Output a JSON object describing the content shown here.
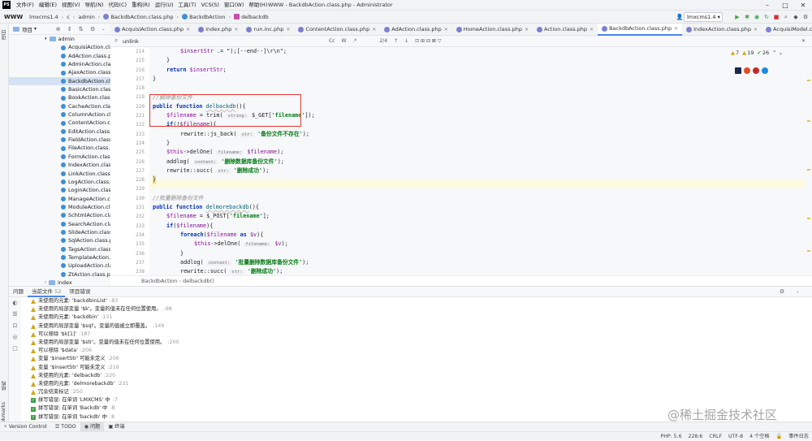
{
  "menu": {
    "items": [
      "文件(F)",
      "编辑(E)",
      "视图(V)",
      "导航(N)",
      "代码(C)",
      "重构(R)",
      "运行(U)",
      "工具(T)",
      "VCS(S)",
      "窗口(W)",
      "帮助(H)"
    ],
    "window_title": "WWW - BackdbAction.class.php - Administrator"
  },
  "nav": {
    "brand": "WWW",
    "crumbs": [
      "lmxcms1.4",
      "c",
      "admin",
      "BackdbAction.class.php",
      "BackdbAction",
      "delbackdb"
    ],
    "run_config": "lmxcms1.4"
  },
  "project": {
    "title": "项目",
    "folder": "admin",
    "files": [
      "AcquisiAction.class.php",
      "AdAction.class.php",
      "AdminAction.class.php",
      "AjaxAction.class.php",
      "BackdbAction.class.php",
      "BasicAction.class.php",
      "BookAction.class.php",
      "CacheAction.class.php",
      "ColumnAction.class.php",
      "ContentAction.class.php",
      "EditAction.class.php",
      "FieldAction.class.php",
      "FileAction.class.php",
      "FormAction.class.php",
      "IndexAction.class.php",
      "LinkAction.class.php",
      "LogAction.class.php",
      "LoginAction.class.php",
      "ManageAction.class.php",
      "ModuleAction.class.php",
      "SchtmlAction.class.php",
      "SearchAction.class.php",
      "SlideAction.class.php",
      "SqlAction.class.php",
      "TagsAction.class.php",
      "TemplateAction.class.php",
      "UploadAction.class.php",
      "ZtAction.class.php"
    ],
    "next_folder": "index"
  },
  "tabs": [
    "AcquisiAction.class.php",
    "index.php",
    "run.inc.php",
    "ContentAction.class.php",
    "AdAction.class.php",
    "HomeAction.class.php",
    "Action.class.php",
    "BackdbAction.class.php",
    "IndexAction.class.php",
    "AcquisiModel.class.php"
  ],
  "search": {
    "query": "unlink",
    "count": "2/4",
    "opts": [
      "Cc",
      "W",
      ".*"
    ]
  },
  "inspections": {
    "warnings": "7",
    "weak": "19",
    "typos": "26"
  },
  "line_numbers": [
    "214",
    "215",
    "216",
    "217",
    "218",
    "219",
    "220",
    "221",
    "222",
    "223",
    "224",
    "225",
    "226",
    "227",
    "228",
    "229",
    "230",
    "231",
    "232",
    "233",
    "234",
    "235",
    "236",
    "237",
    "238"
  ],
  "code": {
    "l214_var": "$insertStr",
    "l214_rest": " .= \");[--end--]\\r\\n\";",
    "l215": "}",
    "l216_kw": "return",
    "l216_var": "$insertStr",
    "l216_end": ";",
    "l217": "}",
    "l219_cmt": "//删除备份文件",
    "l220_kw": "public function",
    "l220_fn": "delbackdb",
    "l220_end": "(){",
    "l221_var": "$filename",
    "l221_a": " = trim(",
    "l221_hint": "string:",
    "l221_b": " $_GET[",
    "l221_str": "'filename'",
    "l221_c": "]);",
    "l222_kw": "if",
    "l222_a": "(!",
    "l222_var": "$filename",
    "l222_b": "){",
    "l223_a": "rewrite::js_back(",
    "l223_hint": "str:",
    "l223_str": "'备份文件不存在'",
    "l223_b": ");",
    "l224": "}",
    "l225_a": "$this",
    "l225_b": "->delOne(",
    "l225_hint": "filename:",
    "l225_var": "$filename",
    "l225_c": ");",
    "l226_a": "addlog(",
    "l226_hint": "content:",
    "l226_str": "'删除数据库备份文件'",
    "l226_b": ");",
    "l227_a": "rewrite::succ(",
    "l227_hint": "str:",
    "l227_str": "'删除成功'",
    "l227_b": ");",
    "l228": "}",
    "l230_cmt": "//批量删除备份文件",
    "l231_kw": "public function",
    "l231_fn": "delmorebackdb",
    "l231_end": "(){",
    "l232_var": "$filename",
    "l232_a": " = $_POST[",
    "l232_str": "'filename'",
    "l232_b": "];",
    "l233_kw": "if",
    "l233_a": "(",
    "l233_var": "$filename",
    "l233_b": "){",
    "l234_kw": "foreach",
    "l234_a": "(",
    "l234_var": "$filename",
    "l234_kw2": " as ",
    "l234_var2": "$v",
    "l234_b": "){",
    "l235_a": "$this",
    "l235_b": "->delOne(",
    "l235_hint": "filename:",
    "l235_var": "$v",
    "l235_c": ");",
    "l236": "}",
    "l237_a": "addlog(",
    "l237_hint": "content:",
    "l237_str": "'批量删除数据库备份文件'",
    "l237_b": ");",
    "l238_a": "rewrite::succ(",
    "l238_hint": "str:",
    "l238_str": "'删除成功'",
    "l238_b": ");"
  },
  "editor_breadcrumb": [
    "BackdbAction",
    "delbackdb()"
  ],
  "problems": {
    "tabs": [
      "问题",
      "当前文件",
      "项目错误"
    ],
    "current_count": "52",
    "items": [
      {
        "type": "warn",
        "text": "未使用的元素: 'backdbinList'",
        "loc": ":83"
      },
      {
        "type": "warn",
        "text": "未使用的局部变量 '$k'。变量的值未在任何位置使用。",
        "loc": ":98"
      },
      {
        "type": "warn",
        "text": "未使用的元素: 'backdbin'",
        "loc": ":131"
      },
      {
        "type": "warn",
        "text": "未使用的局部变量 '$sql'。变量的值被立即覆盖。",
        "loc": ":149"
      },
      {
        "type": "warn",
        "text": "可以移除 '$k[1]'",
        "loc": ":187"
      },
      {
        "type": "warn",
        "text": "未使用的局部变量 '$str'。变量的值未在任何位置使用。",
        "loc": ":200"
      },
      {
        "type": "warn",
        "text": "可以移除 '$data'",
        "loc": ":206"
      },
      {
        "type": "warn",
        "text": "变量 '$insertStr' 可能未定义",
        "loc": ":206"
      },
      {
        "type": "warn",
        "text": "变量 '$insertStr' 可能未定义",
        "loc": ":216"
      },
      {
        "type": "warn",
        "text": "未使用的元素: 'delbackdb'",
        "loc": ":220"
      },
      {
        "type": "warn",
        "text": "未使用的元素: 'delmorebackdb'",
        "loc": ":231"
      },
      {
        "type": "warn",
        "text": "冗余结束标记",
        "loc": ":250"
      },
      {
        "type": "ok",
        "text": "拼写错误: 在单词 'LMXCMS' 中",
        "loc": ":7"
      },
      {
        "type": "ok",
        "text": "拼写错误: 在单词 'Backdb' 中",
        "loc": ":8"
      },
      {
        "type": "ok",
        "text": "拼写错误: 在单词 'backdb' 中",
        "loc": ":8"
      }
    ]
  },
  "bottom_tabs": [
    "Version Control",
    "TODO",
    "问题",
    "终端"
  ],
  "left_strip": [
    "项目",
    "结构",
    "Bookmarks"
  ],
  "status": {
    "php": "PHP: 5.6",
    "pos": "228:6",
    "eol": "CRLF",
    "enc": "UTF-8",
    "indent": "4 个空格",
    "event": "事件日志"
  },
  "watermark": "@稀土掘金技术社区"
}
